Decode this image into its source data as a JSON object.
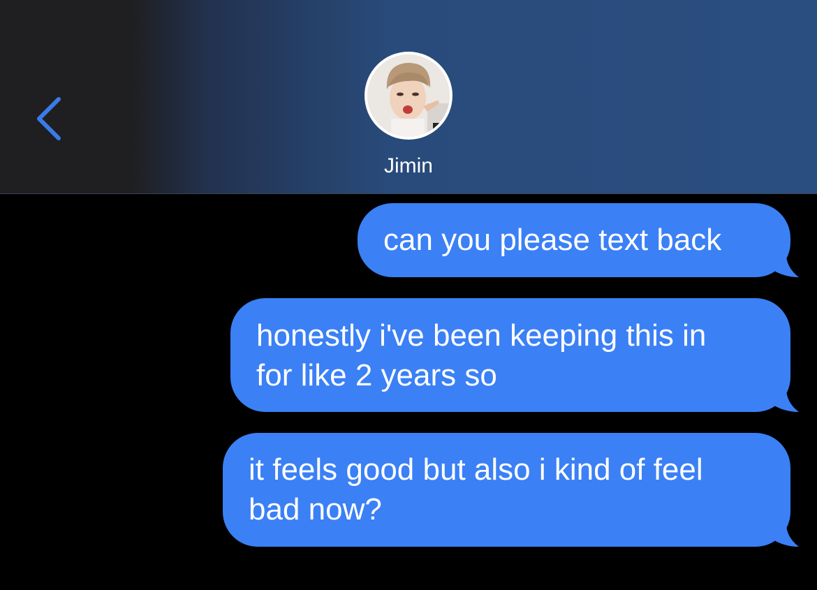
{
  "header": {
    "contact_name": "Jimin",
    "back_icon": "chevron-left-icon",
    "avatar_icon": "contact-avatar"
  },
  "messages": [
    {
      "direction": "outgoing",
      "lines": [
        "can you please text back"
      ]
    },
    {
      "direction": "outgoing",
      "lines": [
        "honestly i've been keeping this in",
        "for like 2 years so"
      ]
    },
    {
      "direction": "outgoing",
      "lines": [
        "it feels good but also i kind of feel",
        "bad now?"
      ]
    }
  ],
  "colors": {
    "bubble_outgoing": "#3b80f5",
    "accent": "#3a7bea",
    "background": "#000000",
    "header_blue": "#2a4e80",
    "header_dark": "#1f1f21"
  }
}
